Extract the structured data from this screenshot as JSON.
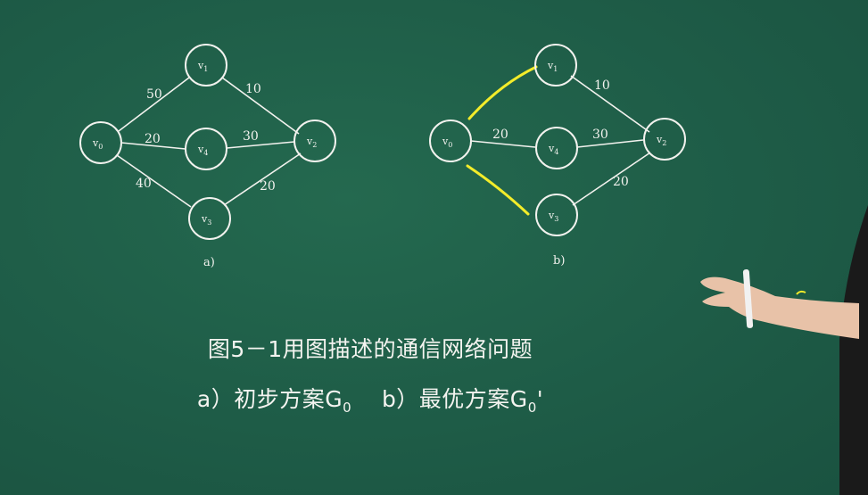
{
  "diagram": {
    "graph_a": {
      "panel_label": "a)",
      "nodes": [
        {
          "id": "v0",
          "sub": "0"
        },
        {
          "id": "v1",
          "sub": "1"
        },
        {
          "id": "v4",
          "sub": "4"
        },
        {
          "id": "v2",
          "sub": "2"
        },
        {
          "id": "v3",
          "sub": "3"
        }
      ],
      "edges": [
        {
          "from": "v0",
          "to": "v1",
          "weight": "50"
        },
        {
          "from": "v0",
          "to": "v4",
          "weight": "20"
        },
        {
          "from": "v0",
          "to": "v3",
          "weight": "40"
        },
        {
          "from": "v1",
          "to": "v2",
          "weight": "10"
        },
        {
          "from": "v4",
          "to": "v2",
          "weight": "30"
        },
        {
          "from": "v3",
          "to": "v2",
          "weight": "20"
        }
      ]
    },
    "graph_b": {
      "panel_label": "b)",
      "nodes": [
        {
          "id": "v0",
          "sub": "0"
        },
        {
          "id": "v1",
          "sub": "1"
        },
        {
          "id": "v4",
          "sub": "4"
        },
        {
          "id": "v2",
          "sub": "2"
        },
        {
          "id": "v3",
          "sub": "3"
        }
      ],
      "edges": [
        {
          "from": "v0",
          "to": "v4",
          "weight": "20"
        },
        {
          "from": "v1",
          "to": "v2",
          "weight": "10"
        },
        {
          "from": "v4",
          "to": "v2",
          "weight": "30"
        },
        {
          "from": "v3",
          "to": "v2",
          "weight": "20"
        }
      ],
      "highlight_color": "#f3ec2a"
    }
  },
  "caption": {
    "line1": "图5－1用图描述的通信网络问题",
    "line2_a_prefix": "a）初步方案G",
    "line2_a_sub": "0",
    "line2_b_prefix": "b）最优方案G",
    "line2_b_sub": "0",
    "line2_b_suffix": "'"
  },
  "colors": {
    "board": "#1f5e4a",
    "chalk": "#f2f2ee",
    "highlight": "#f3ec2a"
  }
}
